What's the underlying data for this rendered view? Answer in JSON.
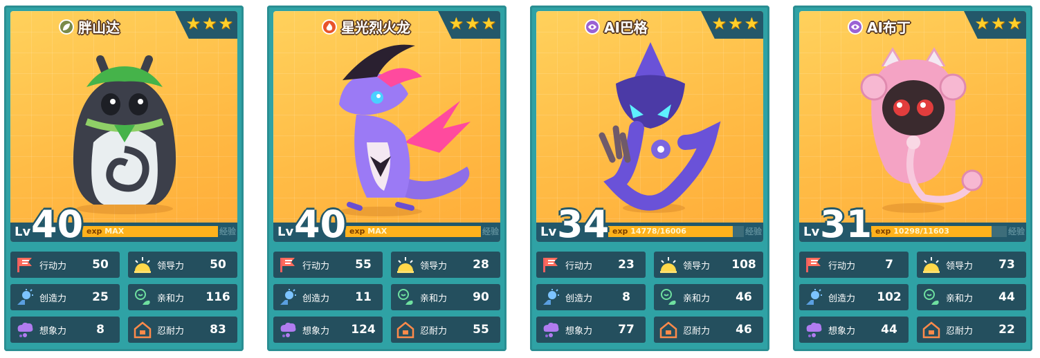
{
  "cards": [
    {
      "name": "胖山达",
      "element": "grass",
      "level": "40",
      "exp_current": "MAX",
      "exp_total": "",
      "exp_fraction": 1.0,
      "exp_label": "exp",
      "exp_tag": "经验",
      "stars": 3,
      "stats": {
        "action": "50",
        "leadership": "50",
        "creativity": "25",
        "affinity": "116",
        "imagination": "8",
        "endurance": "83"
      }
    },
    {
      "name": "星光烈火龙",
      "element": "fire",
      "level": "40",
      "exp_current": "MAX",
      "exp_total": "",
      "exp_fraction": 1.0,
      "exp_label": "exp",
      "exp_tag": "经验",
      "stars": 3,
      "stats": {
        "action": "55",
        "leadership": "28",
        "creativity": "11",
        "affinity": "90",
        "imagination": "124",
        "endurance": "55"
      }
    },
    {
      "name": "AI巴格",
      "element": "psychic",
      "level": "34",
      "exp_current": "14778",
      "exp_total": "/16006",
      "exp_fraction": 0.92,
      "exp_label": "exp",
      "exp_tag": "经验",
      "stars": 3,
      "stats": {
        "action": "23",
        "leadership": "108",
        "creativity": "8",
        "affinity": "46",
        "imagination": "77",
        "endurance": "46"
      }
    },
    {
      "name": "AI布丁",
      "element": "psychic",
      "level": "31",
      "exp_current": "10298",
      "exp_total": "/11603",
      "exp_fraction": 0.89,
      "exp_label": "exp",
      "exp_tag": "经验",
      "stars": 3,
      "stats": {
        "action": "7",
        "leadership": "73",
        "creativity": "102",
        "affinity": "44",
        "imagination": "44",
        "endurance": "22"
      }
    }
  ],
  "stat_labels": {
    "action": "行动力",
    "leadership": "领导力",
    "creativity": "创造力",
    "affinity": "亲和力",
    "imagination": "想象力",
    "endurance": "忍耐力"
  },
  "lv_prefix": "Lv",
  "colors": {
    "card_bg": "#2fa2a5",
    "panel": "#244f5e",
    "exp_fill": "#ffb21c",
    "star": "#ffcf2a",
    "art_bg": "#ffc24a"
  },
  "icons": {
    "action": "flag-icon",
    "leadership": "sunrise-icon",
    "creativity": "lightbulb-icon",
    "affinity": "heart-person-icon",
    "imagination": "cloud-person-icon",
    "endurance": "house-icon"
  }
}
